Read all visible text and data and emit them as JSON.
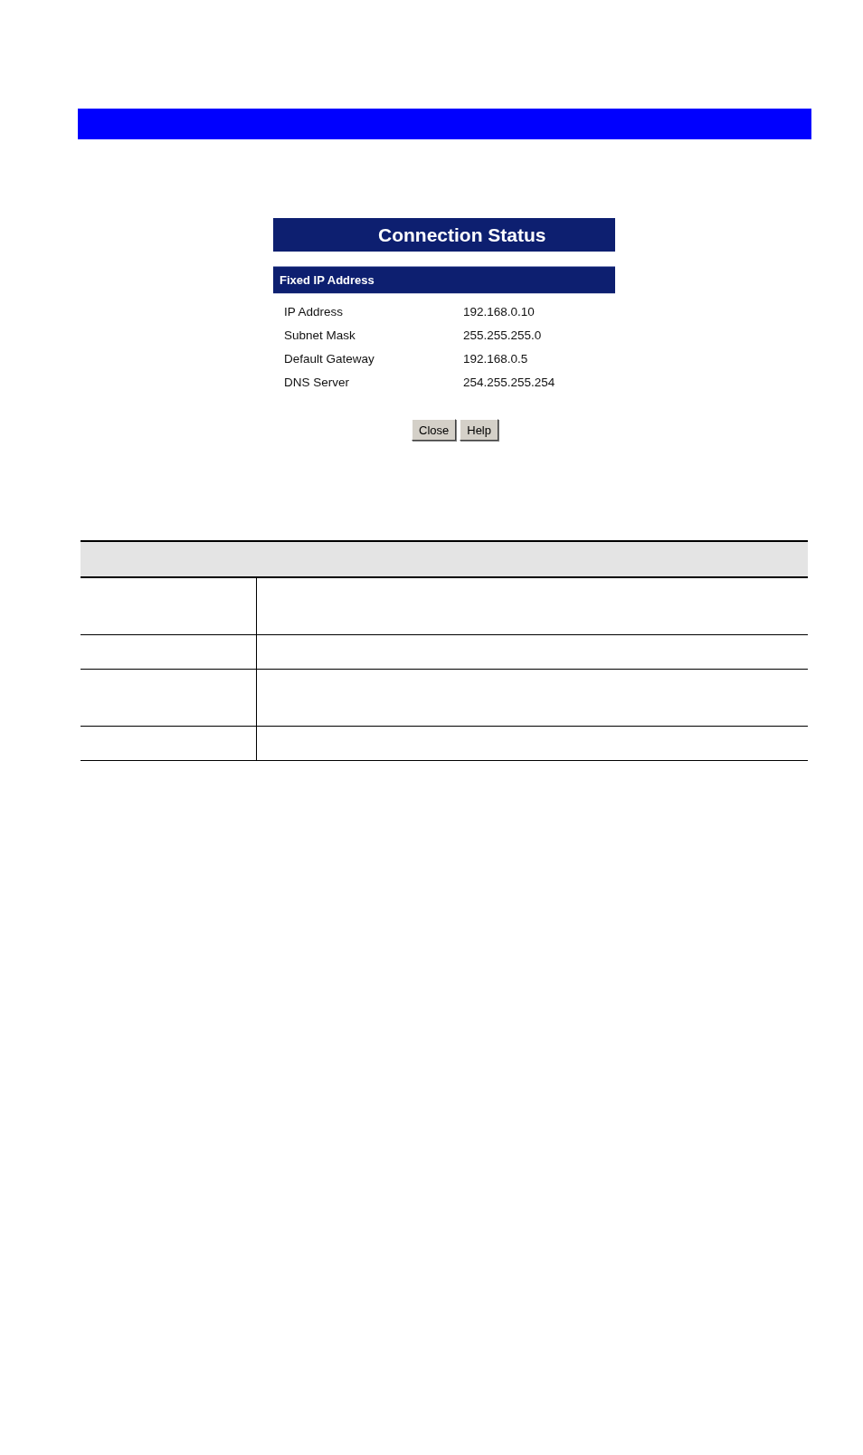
{
  "dialog": {
    "title": "Connection Status",
    "section": "Fixed IP Address",
    "fields": [
      {
        "label": "IP Address",
        "value": "192.168.0.10"
      },
      {
        "label": "Subnet Mask",
        "value": "255.255.255.0"
      },
      {
        "label": "Default Gateway",
        "value": "192.168.0.5"
      },
      {
        "label": "DNS Server",
        "value": "254.255.255.254"
      }
    ],
    "buttons": [
      "Close",
      "Help"
    ]
  }
}
